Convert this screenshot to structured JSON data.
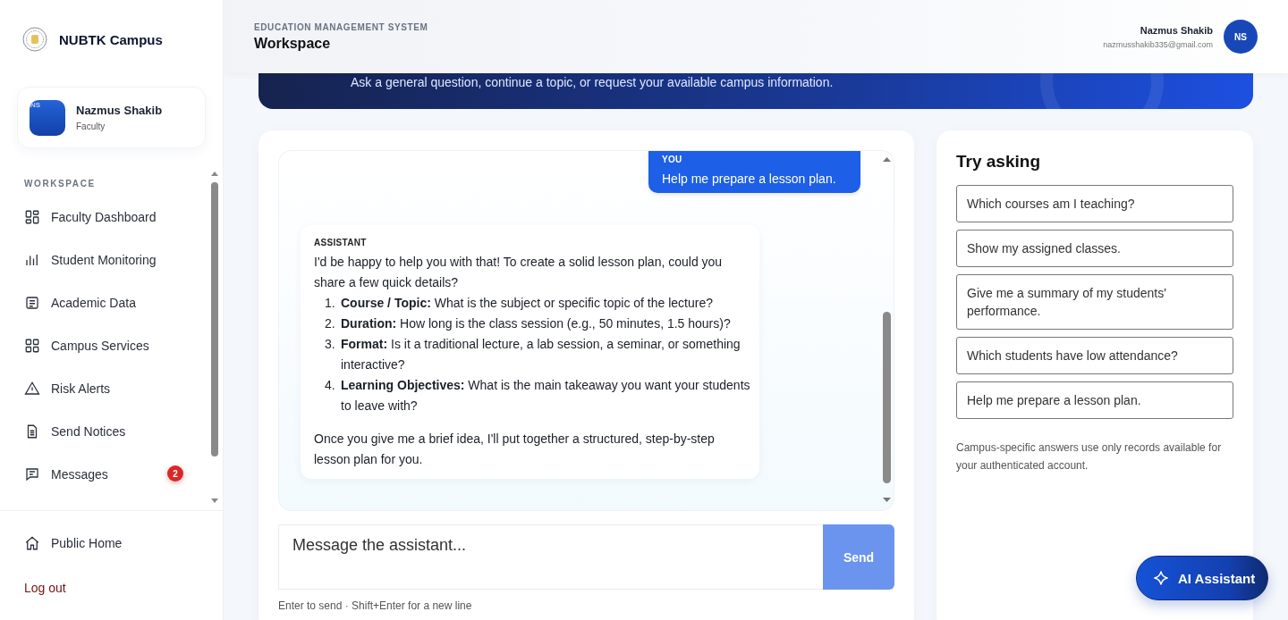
{
  "brand": {
    "name": "NUBTK Campus"
  },
  "profile_card": {
    "initials": "NS",
    "name": "Nazmus Shakib",
    "role": "Faculty"
  },
  "sidebar": {
    "section_title": "WORKSPACE",
    "items": [
      {
        "label": "Faculty Dashboard",
        "kind": "dashboard"
      },
      {
        "label": "Student Monitoring",
        "kind": "bars"
      },
      {
        "label": "Academic Data",
        "kind": "document"
      },
      {
        "label": "Campus Services",
        "kind": "grid"
      },
      {
        "label": "Risk Alerts",
        "kind": "warning"
      },
      {
        "label": "Send Notices",
        "kind": "file"
      },
      {
        "label": "Messages",
        "kind": "message",
        "badge": "2"
      }
    ],
    "footer_items": [
      {
        "label": "Public Home",
        "kind": "home"
      },
      {
        "label": "Log out",
        "kind": "logout"
      }
    ]
  },
  "header": {
    "eyebrow": "EDUCATION MANAGEMENT SYSTEM",
    "title": "Workspace",
    "user": {
      "name": "Nazmus Shakib",
      "email": "nazmusshakib335@gmail.com",
      "initials": "NS"
    }
  },
  "banner": {
    "text": "Ask a general question, continue a topic, or request your available campus information."
  },
  "chat": {
    "messages": [
      {
        "kind": "user",
        "sender": "YOU",
        "text": "Help me prepare a lesson plan."
      },
      {
        "kind": "assistant",
        "sender": "ASSISTANT",
        "intro": "I'd be happy to help you with that! To create a solid lesson plan, could you share a few quick details?",
        "list": [
          {
            "marker": "1.",
            "text": "**Course / Topic:** What is the subject or specific topic of the lecture?"
          },
          {
            "marker": "2.",
            "text": "**Duration:** How long is the class session (e.g., 50 minutes, 1.5 hours)?"
          },
          {
            "marker": "3.",
            "text": "**Format:** Is it a traditional lecture, a lab session, a seminar, or something interactive?"
          },
          {
            "marker": "4.",
            "text": "**Learning Objectives:** What is the main takeaway you want your students to leave with?"
          }
        ],
        "outro": "Once you give me a brief idea, I'll put together a structured, step-by-step lesson plan for you."
      }
    ],
    "composer": {
      "placeholder": "Message the assistant...",
      "button": "Send",
      "button_disabled": true,
      "hint": "Enter to send · Shift+Enter for a new line"
    }
  },
  "suggestions": {
    "title": "Try asking",
    "items": [
      "Which courses am I teaching?",
      "Show my assigned classes.",
      "Give me a summary of my students' performance.",
      "Which students have low attendance?",
      "Help me prepare a lesson plan."
    ],
    "note": "Campus-specific answers use only records available for your authenticated account."
  },
  "fab": {
    "label": "AI Assistant"
  }
}
